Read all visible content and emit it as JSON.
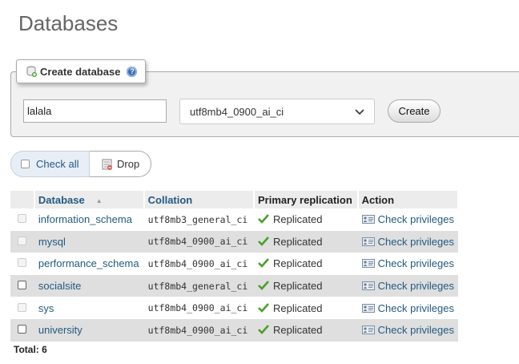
{
  "page": {
    "title": "Databases"
  },
  "create": {
    "legend": "Create database",
    "db_name_value": "lalala",
    "collation_selected": "utf8mb4_0900_ai_ci",
    "create_label": "Create"
  },
  "actions": {
    "check_all_label": "Check all",
    "drop_label": "Drop"
  },
  "table": {
    "headers": {
      "database": "Database",
      "collation": "Collation",
      "replication": "Primary replication",
      "action": "Action"
    },
    "rows": [
      {
        "name": "information_schema",
        "collation": "utf8mb3_general_ci",
        "replication": "Replicated",
        "action": "Check privileges",
        "checkbox_enabled": false
      },
      {
        "name": "mysql",
        "collation": "utf8mb4_0900_ai_ci",
        "replication": "Replicated",
        "action": "Check privileges",
        "checkbox_enabled": false
      },
      {
        "name": "performance_schema",
        "collation": "utf8mb4_0900_ai_ci",
        "replication": "Replicated",
        "action": "Check privileges",
        "checkbox_enabled": false
      },
      {
        "name": "socialsite",
        "collation": "utf8mb4_general_ci",
        "replication": "Replicated",
        "action": "Check privileges",
        "checkbox_enabled": true
      },
      {
        "name": "sys",
        "collation": "utf8mb4_0900_ai_ci",
        "replication": "Replicated",
        "action": "Check privileges",
        "checkbox_enabled": false
      },
      {
        "name": "university",
        "collation": "utf8mb4_0900_ai_ci",
        "replication": "Replicated",
        "action": "Check privileges",
        "checkbox_enabled": true
      }
    ],
    "total_label": "Total: 6"
  },
  "icons": {
    "create_db": "database-add-icon",
    "help": "help-icon",
    "dropdown": "chevron-down-icon",
    "drop": "drop-icon",
    "sort": "sort-ascending-icon",
    "replicated": "checkmark-icon",
    "privileges": "privileges-icon"
  },
  "colors": {
    "link": "#235a81",
    "replicated_check": "#4aa02c",
    "row_alt": "#dfdfdf"
  }
}
